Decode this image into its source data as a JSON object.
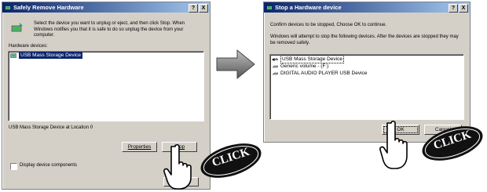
{
  "dialog1": {
    "title": "Safely Remove Hardware",
    "help": "?",
    "close": "X",
    "description": "Select the device you want to unplug or eject, and then click Stop. When Windows notifies you that it is safe to do so unplug the device from your computer.",
    "devices_label": "Hardware devices:",
    "devices": [
      "USB Mass Storage Device"
    ],
    "location": "USB Mass Storage Device at Location 0",
    "properties_button": "Properties",
    "stop_button": "Stop",
    "checkbox_label": "Display device components"
  },
  "dialog2": {
    "title": "Stop a Hardware device",
    "help": "?",
    "close": "X",
    "line1": "Confirm devices to be stopped, Choose OK to continue.",
    "line2": "Windows will attempt to stop the following devices. After the devices are stopped they may be removed safely.",
    "devices": [
      "USB Mass Storage Device",
      "Generic volume - (F:)",
      "DIGITAL AUDIO PLAYER USB Device"
    ],
    "ok_button": "OK",
    "cancel_button": "Cancel"
  },
  "click_label": "CLICK",
  "colors": {
    "titlebar": "#0a246a",
    "selection": "#0a246a",
    "window": "#d4d0c8"
  }
}
